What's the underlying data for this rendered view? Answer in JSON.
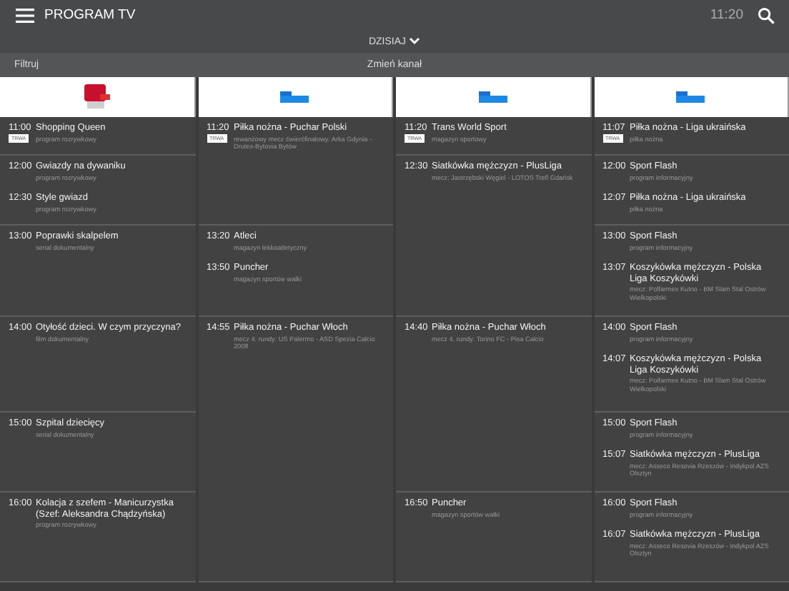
{
  "app_bar": {
    "title": "PROGRAM TV",
    "clock": "11:20"
  },
  "day_selector": {
    "label": "DZISIAJ"
  },
  "toolbar": {
    "filter": "Filtruj",
    "change_channel": "Zmień kanał"
  },
  "channels": [
    {
      "hours": [
        {
          "divider": true,
          "programs": [
            {
              "time": "11:00",
              "title": "Shopping Queen",
              "subtitle": "program rozrywkowy",
              "badge": "TRWA"
            }
          ]
        },
        {
          "divider": true,
          "programs": [
            {
              "time": "12:00",
              "title": "Gwiazdy na dywaniku",
              "subtitle": "program rozrywkowy"
            },
            {
              "time": "12:30",
              "title": "Style gwiazd",
              "subtitle": "program rozrywkowy"
            }
          ]
        },
        {
          "divider": true,
          "programs": [
            {
              "time": "13:00",
              "title": "Poprawki skalpelem",
              "subtitle": "serial dokumentalny"
            }
          ]
        },
        {
          "divider": true,
          "programs": [
            {
              "time": "14:00",
              "title": "Otyłość dzieci. W czym przyczyna?",
              "subtitle": "film dokumentalny"
            }
          ]
        },
        {
          "divider": true,
          "programs": [
            {
              "time": "15:00",
              "title": "Szpital dziecięcy",
              "subtitle": "serial dokumentalny"
            }
          ]
        },
        {
          "divider": true,
          "programs": [
            {
              "time": "16:00",
              "title": "Kolacja z szefem - Manicurzystka (Szef: Aleksandra Chądzyńska)",
              "subtitle": "program rozrywkowy"
            }
          ]
        }
      ]
    },
    {
      "hours": [
        {
          "divider": false,
          "programs": [
            {
              "time": "11:20",
              "title": "Piłka nożna - Puchar Polski",
              "subtitle": "rewanżowy mecz ćwierćfinałowy: Arka Gdynia - Drutex-Bytovia Bytów",
              "badge": "TRWA"
            }
          ]
        },
        {
          "divider": true
        },
        {
          "divider": true,
          "programs": [
            {
              "time": "13:20",
              "title": "Atleci",
              "subtitle": "magazyn lekkoatletyczny"
            },
            {
              "time": "13:50",
              "title": "Puncher",
              "subtitle": "magazyn sportów walki"
            }
          ]
        },
        {
          "divider": false,
          "programs": [
            {
              "time": "14:55",
              "title": "Piłka nożna - Puchar Włoch",
              "subtitle": "mecz 4. rundy: US Palermo - ASD Spezia Calcio 2008"
            }
          ]
        },
        {
          "divider": false
        },
        {
          "divider": true
        }
      ]
    },
    {
      "hours": [
        {
          "divider": true,
          "programs": [
            {
              "time": "11:20",
              "title": "Trans World Sport",
              "subtitle": "magazyn sportowy",
              "badge": "TRWA"
            }
          ]
        },
        {
          "divider": false,
          "programs": [
            {
              "time": "12:30",
              "title": "Siatkówka mężczyzn - PlusLiga",
              "subtitle": "mecz: Jastrzębski Węgiel - LOTOS Trefl Gdańsk"
            }
          ]
        },
        {
          "divider": true
        },
        {
          "divider": false,
          "programs": [
            {
              "time": "14:40",
              "title": "Piłka nożna - Puchar Włoch",
              "subtitle": "mecz 4. rundy: Torino FC - Pisa Calcio"
            }
          ]
        },
        {
          "divider": true
        },
        {
          "divider": true,
          "programs": [
            {
              "time": "16:50",
              "title": "Puncher",
              "subtitle": "magazyn sportów walki"
            }
          ]
        }
      ]
    },
    {
      "hours": [
        {
          "divider": true,
          "programs": [
            {
              "time": "11:07",
              "title": "Piłka nożna - Liga ukraińska",
              "subtitle": "piłka nożna",
              "badge": "TRWA"
            }
          ]
        },
        {
          "divider": true,
          "programs": [
            {
              "time": "12:00",
              "title": "Sport Flash",
              "subtitle": "program informacyjny"
            },
            {
              "time": "12:07",
              "title": "Piłka nożna - Liga ukraińska",
              "subtitle": "piłka nożna"
            }
          ]
        },
        {
          "divider": true,
          "programs": [
            {
              "time": "13:00",
              "title": "Sport Flash",
              "subtitle": "program informacyjny"
            },
            {
              "time": "13:07",
              "title": "Koszykówka mężczyzn - Polska Liga Koszykówki",
              "subtitle": "mecz: Polfarmex Kutno - BM Slam Stal Ostrów Wielkopolski"
            }
          ]
        },
        {
          "divider": true,
          "programs": [
            {
              "time": "14:00",
              "title": "Sport Flash",
              "subtitle": "program informacyjny"
            },
            {
              "time": "14:07",
              "title": "Koszykówka mężczyzn - Polska Liga Koszykówki",
              "subtitle": "mecz: Polfarmex Kutno - BM Slam Stal Ostrów Wielkopolski"
            }
          ]
        },
        {
          "divider": true,
          "programs": [
            {
              "time": "15:00",
              "title": "Sport Flash",
              "subtitle": "program informacyjny"
            },
            {
              "time": "15:07",
              "title": "Siatkówka mężczyzn - PlusLiga",
              "subtitle": "mecz: Asseco Resovia Rzeszów - Indykpol AZS Olsztyn"
            }
          ]
        },
        {
          "divider": true,
          "programs": [
            {
              "time": "16:00",
              "title": "Sport Flash",
              "subtitle": "program informacyjny"
            },
            {
              "time": "16:07",
              "title": "Siatkówka mężczyzn - PlusLiga",
              "subtitle": "mecz: Asseco Resovia Rzeszów - Indykpol AZS Olsztyn"
            }
          ]
        }
      ]
    }
  ]
}
